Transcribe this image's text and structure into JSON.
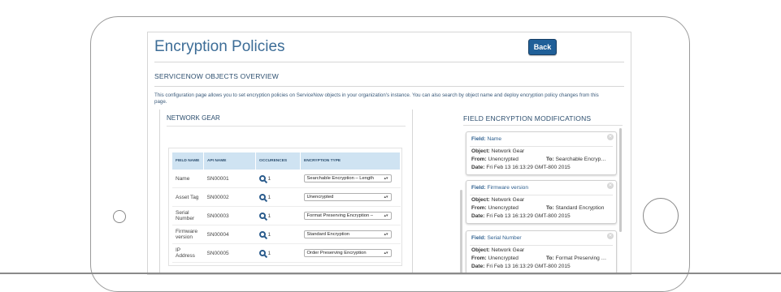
{
  "page": {
    "title": "Encryption Policies",
    "back_label": "Back",
    "section_title": "SERVICENOW OBJECTS OVERVIEW",
    "description": "This configuration page allows you to set encryption policies on ServiceNow objects in your organization's instance. You can also search by object name and deploy encryption policy changes from this page."
  },
  "left_panel": {
    "title": "NETWORK GEAR",
    "columns": [
      "FIELD NAME",
      "API NAME",
      "OCCURENCES",
      "ENCRYPTION TYPE"
    ],
    "rows": [
      {
        "field": "Name",
        "api": "SN00001",
        "occ": "1",
        "enc": "Searchable Encryption – Length"
      },
      {
        "field": "Asset Tag",
        "api": "SN00002",
        "occ": "1",
        "enc": "Unencrypted"
      },
      {
        "field": "Serial Number",
        "api": "SN00003",
        "occ": "1",
        "enc": "Format Preserving Encryption –"
      },
      {
        "field": "Firmware version",
        "api": "SN00004",
        "occ": "1",
        "enc": "Standard Encryption"
      },
      {
        "field": "IP Address",
        "api": "SN00005",
        "occ": "1",
        "enc": "Order Preserving Encryption"
      }
    ]
  },
  "right_panel": {
    "title": "FIELD ENCRYPTION MODIFICATIONS",
    "labels": {
      "field": "Field:",
      "object": "Object:",
      "from": "From:",
      "to": "To:",
      "date": "Date:"
    },
    "cards": [
      {
        "field": "Name",
        "object": "Network Gear",
        "from": "Unencrypted",
        "to": "Searchable Encryp…",
        "date": "Fri Feb 13 16:13:29 GMT-800 2015"
      },
      {
        "field": "Firmware version",
        "object": "Network Gear",
        "from": "Unencrypted",
        "to": "Standard Encryption",
        "date": "Fri Feb 13 16:13:29 GMT-800 2015"
      },
      {
        "field": "Serial Number",
        "object": "Network Gear",
        "from": "Unencrypted",
        "to": "Format Preserving …",
        "date": "Fri Feb 13 16:13:29 GMT-800 2015"
      }
    ]
  },
  "icons": {
    "occurrence": "magnifier-icon",
    "close": "close-icon",
    "dropdown": "chevron-updown-icon"
  },
  "colors": {
    "accent": "#1f5f98",
    "title": "#3d6d97",
    "table_header": "#cfe3f2"
  }
}
